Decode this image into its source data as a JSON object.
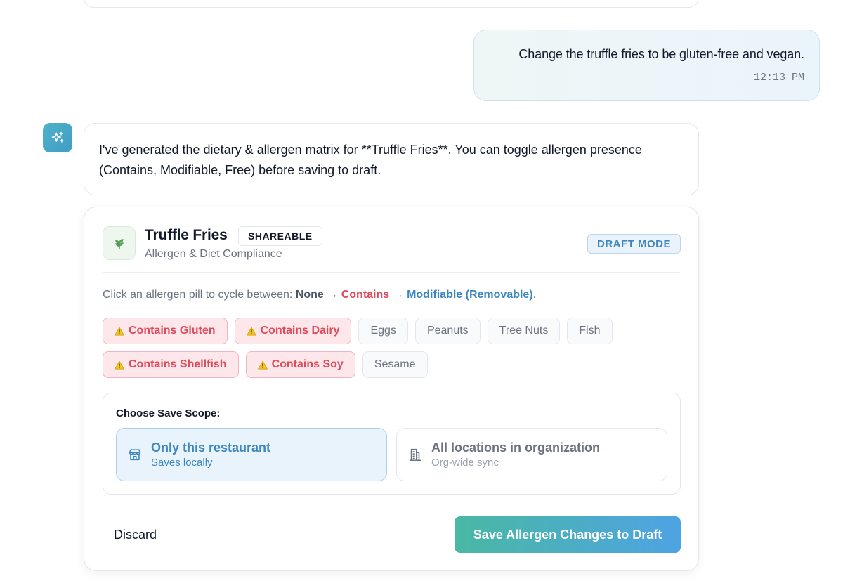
{
  "user_message": {
    "text": "Change the truffle fries to be gluten-free and vegan.",
    "time": "12:13 PM"
  },
  "assistant": {
    "avatar_icon": "sparkle-icon",
    "message": "I've generated the dietary & allergen matrix for **Truffle Fries**. You can toggle allergen presence (Contains, Modifiable, Free) before saving to draft."
  },
  "card": {
    "item_icon": "leaf-icon",
    "title": "Truffle Fries",
    "badge": "SHAREABLE",
    "subtitle": "Allergen & Diet Compliance",
    "mode_badge": "DRAFT MODE",
    "instructions": {
      "prefix": "Click an allergen pill to cycle between:",
      "none": "None",
      "contains": "Contains",
      "modifiable": "Modifiable (Removable)",
      "arrow": "→",
      "end": "."
    },
    "allergens": [
      {
        "label": "Contains Gluten",
        "state": "contains"
      },
      {
        "label": "Contains Dairy",
        "state": "contains"
      },
      {
        "label": "Eggs",
        "state": "none"
      },
      {
        "label": "Peanuts",
        "state": "none"
      },
      {
        "label": "Tree Nuts",
        "state": "none"
      },
      {
        "label": "Fish",
        "state": "none"
      },
      {
        "label": "Contains Shellfish",
        "state": "contains"
      },
      {
        "label": "Contains Soy",
        "state": "contains"
      },
      {
        "label": "Sesame",
        "state": "none"
      }
    ],
    "scope": {
      "label": "Choose Save Scope:",
      "options": [
        {
          "title": "Only this restaurant",
          "desc": "Saves locally",
          "icon": "store-icon",
          "selected": true
        },
        {
          "title": "All locations in organization",
          "desc": "Org-wide sync",
          "icon": "building-icon",
          "selected": false
        }
      ]
    },
    "discard_label": "Discard",
    "save_label": "Save Allergen Changes to Draft"
  },
  "colors": {
    "accent_blue": "#3d87c0",
    "contains_red": "#e04a5a",
    "button_gradient_start": "#4ab8a3",
    "button_gradient_end": "#4ea3e3"
  }
}
